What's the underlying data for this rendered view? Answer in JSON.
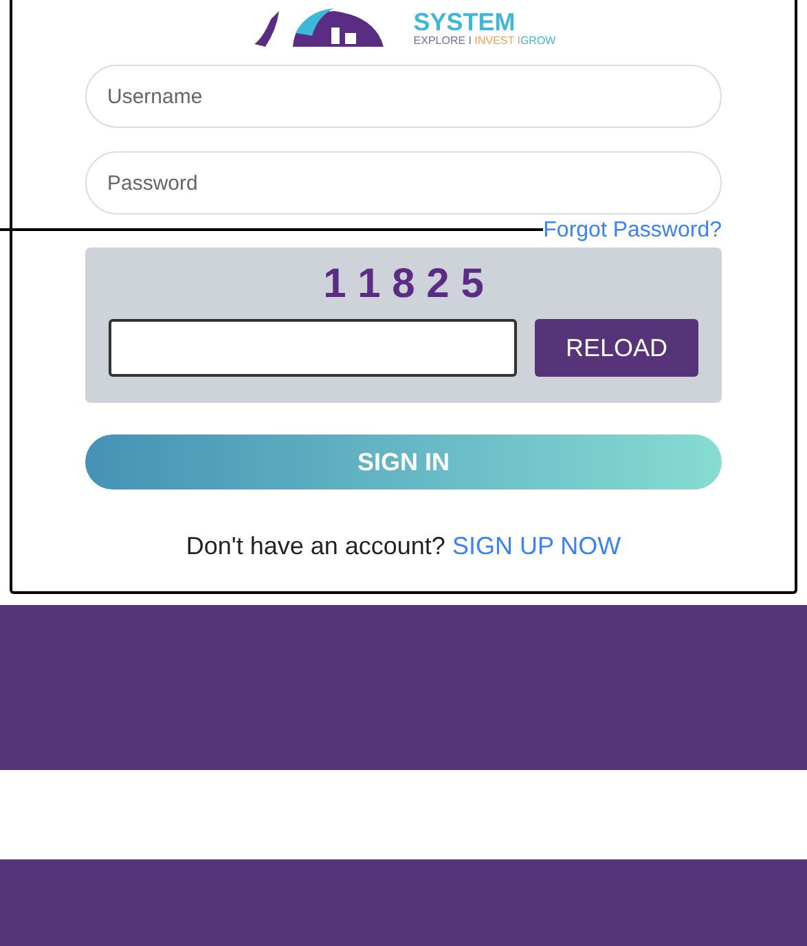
{
  "logo": {
    "title": "SYSTEM",
    "tagline": [
      {
        "text": "EXPLORE I ",
        "color": "#7a6aa8"
      },
      {
        "text": "INVEST I",
        "color": "#f0a050"
      },
      {
        "text": "GROW",
        "color": "#3fb8d8"
      }
    ]
  },
  "form": {
    "username": {
      "placeholder": "Username"
    },
    "password": {
      "placeholder": "Password"
    },
    "forgot_link": "Forgot Password?",
    "captcha": {
      "code": "1 1 8 2 5",
      "reload": "RELOAD"
    },
    "sign_in": "SIGN IN",
    "signup_prompt": "Don't have an account?",
    "signup_link": "SIGN UP NOW"
  }
}
